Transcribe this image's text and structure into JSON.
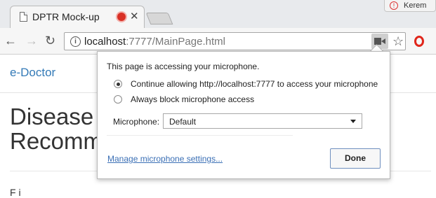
{
  "browser": {
    "tab": {
      "title": "DPTR Mock-up",
      "close": "✕",
      "recording_icon": "recording-dot-icon"
    },
    "profile": {
      "name": "Kerem"
    },
    "toolbar": {
      "url_host": "localhost",
      "url_rest": ":7777/MainPage.html",
      "back": "←",
      "forward": "→",
      "reload": "↻",
      "star": "☆"
    }
  },
  "page": {
    "brand": "e-Doctor",
    "heading_line1": "Disease",
    "heading_line2": "Recomm",
    "footer_partial": "F  i"
  },
  "popup": {
    "title": "This page is accessing your microphone.",
    "options": [
      {
        "label": "Continue allowing http://localhost:7777 to access your microphone",
        "checked": true
      },
      {
        "label": "Always block microphone access",
        "checked": false
      }
    ],
    "mic_label": "Microphone:",
    "mic_value": "Default",
    "manage_link": "Manage microphone settings...",
    "done_label": "Done"
  },
  "colors": {
    "link": "#337ab7",
    "recording": "#d93025",
    "opera": "#e0261b"
  }
}
